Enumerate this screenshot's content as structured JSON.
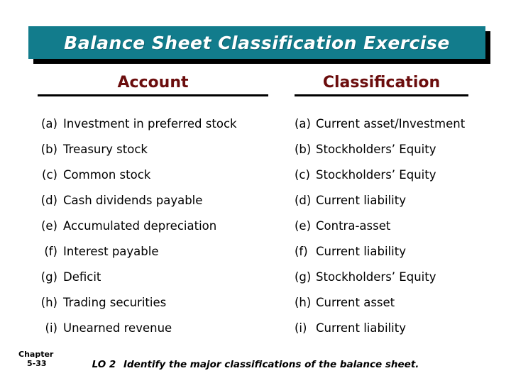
{
  "slide": {
    "title": "Balance Sheet Classification Exercise",
    "banner_color": "#127C8C",
    "banner_shadow_color": "#000000",
    "header_text_color": "#6B0D0D",
    "background_color": "#FFFFFF"
  },
  "table": {
    "headers": {
      "left": "Account",
      "right": "Classification"
    },
    "rows": [
      {
        "marker": "(a)",
        "account": "Investment in preferred stock",
        "classification": "Current asset/Investment"
      },
      {
        "marker": "(b)",
        "account": "Treasury stock",
        "classification": "Stockholders’ Equity"
      },
      {
        "marker": "(c)",
        "account": "Common stock",
        "classification": "Stockholders’ Equity"
      },
      {
        "marker": "(d)",
        "account": "Cash dividends payable",
        "classification": "Current liability"
      },
      {
        "marker": "(e)",
        "account": "Accumulated depreciation",
        "classification": "Contra-asset"
      },
      {
        "marker": "(f)",
        "account": "Interest payable",
        "classification": "Current liability"
      },
      {
        "marker": "(g)",
        "account": "Deficit",
        "classification": "Stockholders’ Equity"
      },
      {
        "marker": "(h)",
        "account": "Trading securities",
        "classification": "Current asset"
      },
      {
        "marker": "(i)",
        "account": "Unearned revenue",
        "classification": "Current liability"
      }
    ]
  },
  "footer": {
    "chapter_label": "Chapter",
    "chapter_number": "5-33",
    "lo_tag": "LO 2",
    "lo_text": "Identify the major classifications of the balance sheet."
  }
}
